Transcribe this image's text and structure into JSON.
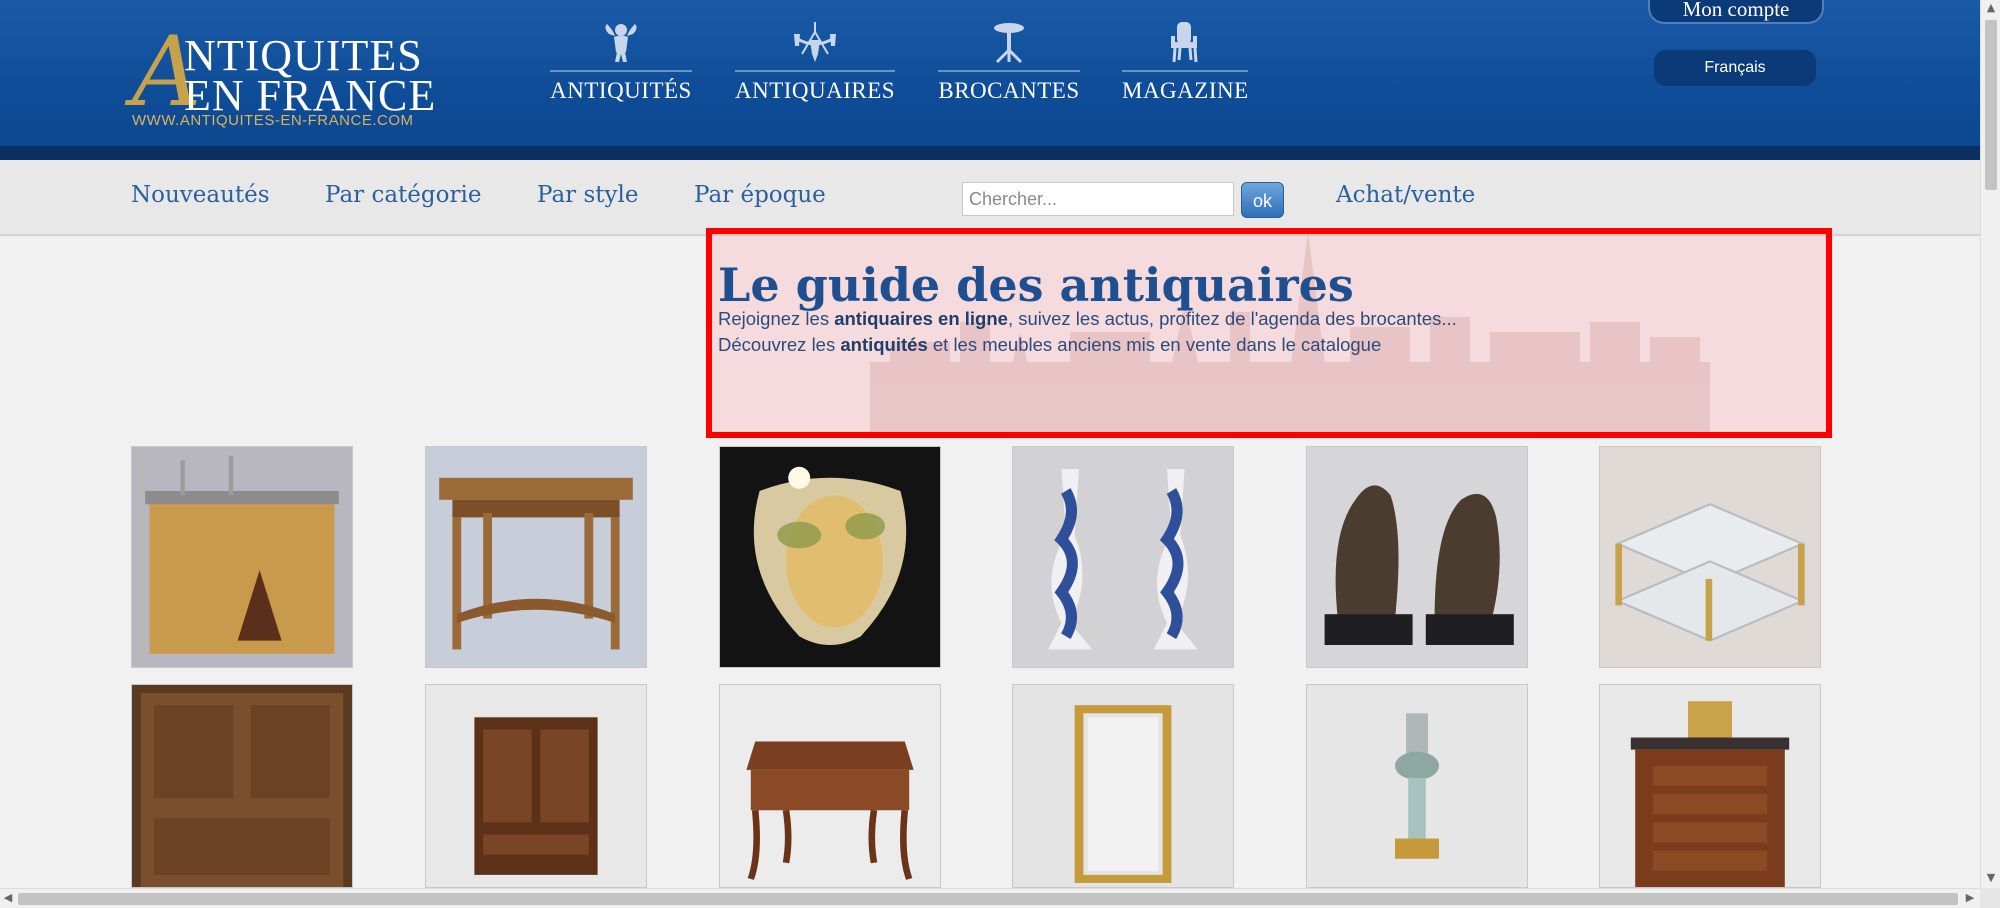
{
  "header": {
    "logo_letter": "A",
    "logo_line1": "NTIQUITES",
    "logo_line2": "EN FRANCE",
    "logo_url": "WWW.ANTIQUITES-EN-FRANCE.COM",
    "account_label": "Mon compte",
    "language_label": "Français"
  },
  "main_nav": [
    {
      "label": "ANTIQUITÉS",
      "icon": "cherub-icon"
    },
    {
      "label": "ANTIQUAIRES",
      "icon": "chandelier-icon"
    },
    {
      "label": "BROCANTES",
      "icon": "table-icon"
    },
    {
      "label": "MAGAZINE",
      "icon": "chair-icon"
    }
  ],
  "sub_nav": {
    "links": [
      "Nouveautés",
      "Par catégorie",
      "Par style",
      "Par époque"
    ],
    "search_placeholder": "Chercher...",
    "search_button": "ok",
    "extra_link": "Achat/vente"
  },
  "hero": {
    "title": "Le guide des antiquaires",
    "line1_pre": "Rejoignez les ",
    "line1_bold": "antiquaires en ligne",
    "line1_post": ", suivez les actus, profitez de l'agenda des brocantes...",
    "line2_pre": "Découvrez les ",
    "line2_bold": "antiquités",
    "line2_post": " et les meubles anciens mis en vente dans le catalogue"
  },
  "products": [
    {
      "name": "oak-bar-counter"
    },
    {
      "name": "barley-twist-side-table"
    },
    {
      "name": "glass-ceiling-lamp"
    },
    {
      "name": "blue-white-candlesticks"
    },
    {
      "name": "bronze-dog-statues"
    },
    {
      "name": "glass-brass-coffee-table"
    },
    {
      "name": "carved-wooden-buffet"
    },
    {
      "name": "walnut-cabinet"
    },
    {
      "name": "louis-xv-writing-desk"
    },
    {
      "name": "gilt-mirror-frame"
    },
    {
      "name": "opaline-oil-lamp"
    },
    {
      "name": "empire-chest-of-drawers"
    }
  ],
  "colors": {
    "header_blue": "#0f4d98",
    "gold": "#c8a24a",
    "link_blue": "#2b5f9e",
    "highlight_red": "#ff0000"
  }
}
